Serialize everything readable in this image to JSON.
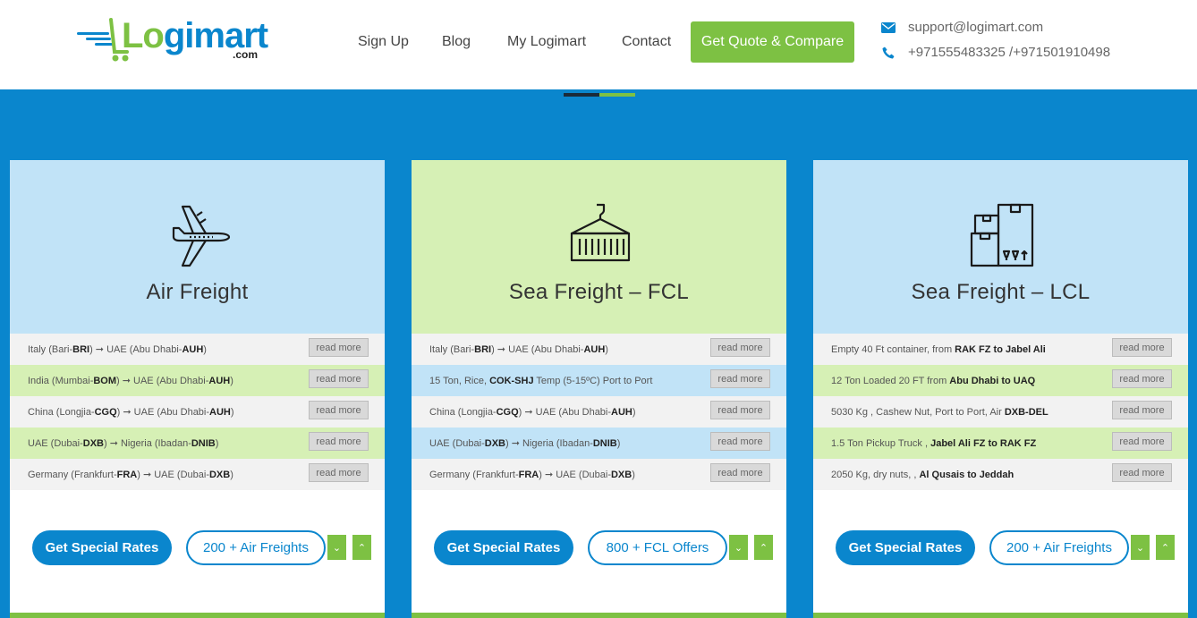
{
  "header": {
    "logo": {
      "word_part1": "Lo",
      "word_part2": "gi",
      "word_part3": "mart",
      "sub": ".com"
    },
    "nav": [
      {
        "label": "Sign Up"
      },
      {
        "label": "Blog"
      },
      {
        "label": "My Logimart"
      },
      {
        "label": "Contact"
      }
    ],
    "cta_label": "Get Quote & Compare",
    "contact": {
      "email": "support@logimart.com",
      "phone": "+971555483325 /+971501910498",
      "email_icon": "envelope-icon",
      "phone_icon": "phone-icon"
    }
  },
  "colors": {
    "primary_blue": "#0a86cd",
    "accent_green": "#7dc143",
    "light_blue": "#c1e3f7",
    "light_green": "#d6f0b5"
  },
  "cards": [
    {
      "title": "Air Freight",
      "icon": "airplane-icon",
      "rows": [
        {
          "segments": [
            [
              "Italy (Bari-",
              false
            ],
            [
              "BRI",
              true
            ],
            [
              ") ➞ UAE (Abu Dhabi-",
              false
            ],
            [
              "AUH",
              true
            ],
            [
              ")",
              false
            ]
          ],
          "read_more": "read more"
        },
        {
          "segments": [
            [
              "India (Mumbai-",
              false
            ],
            [
              "BOM",
              true
            ],
            [
              ") ➞ UAE (Abu Dhabi-",
              false
            ],
            [
              "AUH",
              true
            ],
            [
              ")",
              false
            ]
          ],
          "read_more": "read more"
        },
        {
          "segments": [
            [
              "China (Longjia-",
              false
            ],
            [
              "CGQ",
              true
            ],
            [
              ") ➞ UAE (Abu Dhabi-",
              false
            ],
            [
              "AUH",
              true
            ],
            [
              ")",
              false
            ]
          ],
          "read_more": "read more"
        },
        {
          "segments": [
            [
              "UAE (Dubai-",
              false
            ],
            [
              "DXB",
              true
            ],
            [
              ") ➞ Nigeria (Ibadan-",
              false
            ],
            [
              "DNIB",
              true
            ],
            [
              ")",
              false
            ]
          ],
          "read_more": "read more"
        },
        {
          "segments": [
            [
              "Germany (Frankfurt-",
              false
            ],
            [
              "FRA",
              true
            ],
            [
              ") ➞ UAE (Dubai-",
              false
            ],
            [
              "DXB",
              true
            ],
            [
              ")",
              false
            ]
          ],
          "read_more": "read more"
        }
      ],
      "special_label": "Get Special Rates",
      "count_label": "200 + Air Freights"
    },
    {
      "title": "Sea Freight – FCL",
      "icon": "shipping-container-icon",
      "rows": [
        {
          "segments": [
            [
              "Italy (Bari-",
              false
            ],
            [
              "BRI",
              true
            ],
            [
              ") ➞ UAE (Abu Dhabi-",
              false
            ],
            [
              "AUH",
              true
            ],
            [
              ")",
              false
            ]
          ],
          "read_more": "read more"
        },
        {
          "segments": [
            [
              "15 Ton, Rice, ",
              false
            ],
            [
              "COK-SHJ",
              true
            ],
            [
              " Temp (5-15ºC) Port to Port",
              false
            ]
          ],
          "read_more": "read more"
        },
        {
          "segments": [
            [
              "China (Longjia-",
              false
            ],
            [
              "CGQ",
              true
            ],
            [
              ") ➞ UAE (Abu Dhabi-",
              false
            ],
            [
              "AUH",
              true
            ],
            [
              ")",
              false
            ]
          ],
          "read_more": "read more"
        },
        {
          "segments": [
            [
              "UAE (Dubai-",
              false
            ],
            [
              "DXB",
              true
            ],
            [
              ") ➞ Nigeria (Ibadan-",
              false
            ],
            [
              "DNIB",
              true
            ],
            [
              ")",
              false
            ]
          ],
          "read_more": "read more"
        },
        {
          "segments": [
            [
              "Germany (Frankfurt-",
              false
            ],
            [
              "FRA",
              true
            ],
            [
              ") ➞ UAE (Dubai-",
              false
            ],
            [
              "DXB",
              true
            ],
            [
              ")",
              false
            ]
          ],
          "read_more": "read more"
        }
      ],
      "special_label": "Get Special Rates",
      "count_label": "800 + FCL Offers"
    },
    {
      "title": "Sea Freight – LCL",
      "icon": "stacked-boxes-icon",
      "rows": [
        {
          "segments": [
            [
              "Empty 40 Ft container, from ",
              false
            ],
            [
              "RAK FZ to Jabel Ali",
              true
            ]
          ],
          "read_more": "read more"
        },
        {
          "segments": [
            [
              "12 Ton Loaded 20 FT from ",
              false
            ],
            [
              "Abu Dhabi to UAQ",
              true
            ]
          ],
          "read_more": "read more"
        },
        {
          "segments": [
            [
              "5030 Kg , Cashew Nut, Port to Port, Air ",
              false
            ],
            [
              "DXB-DEL",
              true
            ]
          ],
          "read_more": "read more"
        },
        {
          "segments": [
            [
              "1.5 Ton Pickup Truck , ",
              false
            ],
            [
              "Jabel Ali FZ to RAK FZ",
              true
            ]
          ],
          "read_more": "read more"
        },
        {
          "segments": [
            [
              "2050 Kg, dry nuts, , ",
              false
            ],
            [
              "Al Qusais to Jeddah",
              true
            ]
          ],
          "read_more": "read more"
        }
      ],
      "special_label": "Get Special Rates",
      "count_label": "200 + Air Freights"
    }
  ],
  "arrow_down": "⌄",
  "arrow_up": "⌃"
}
